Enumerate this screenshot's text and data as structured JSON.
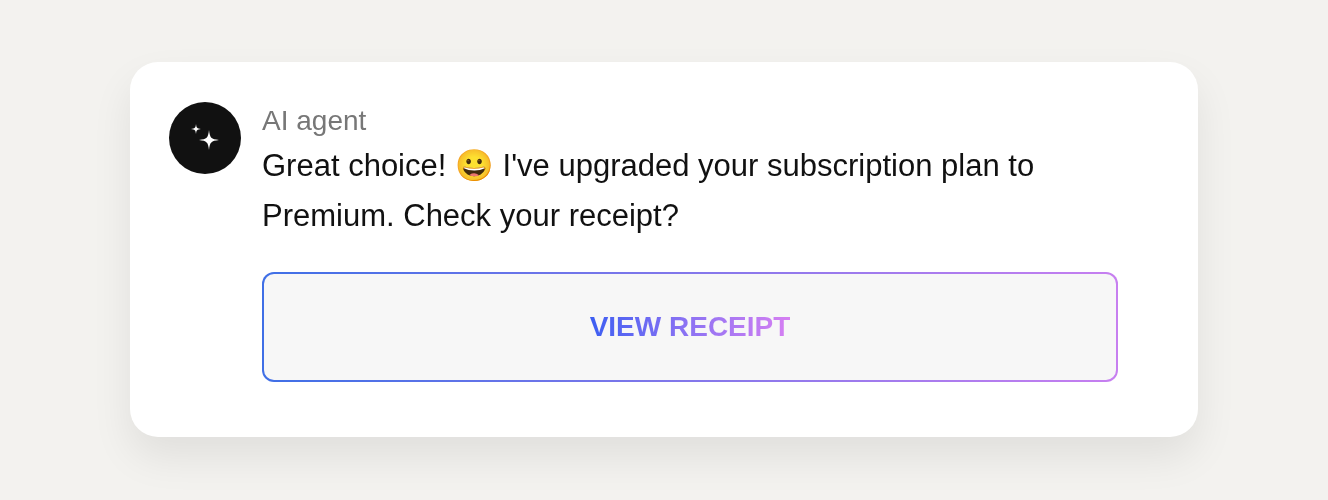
{
  "message": {
    "sender": "AI agent",
    "text": "Great choice! 😀 I've upgraded your subscription plan to Premium. Check your receipt?"
  },
  "button": {
    "label": "VIEW RECEIPT"
  }
}
